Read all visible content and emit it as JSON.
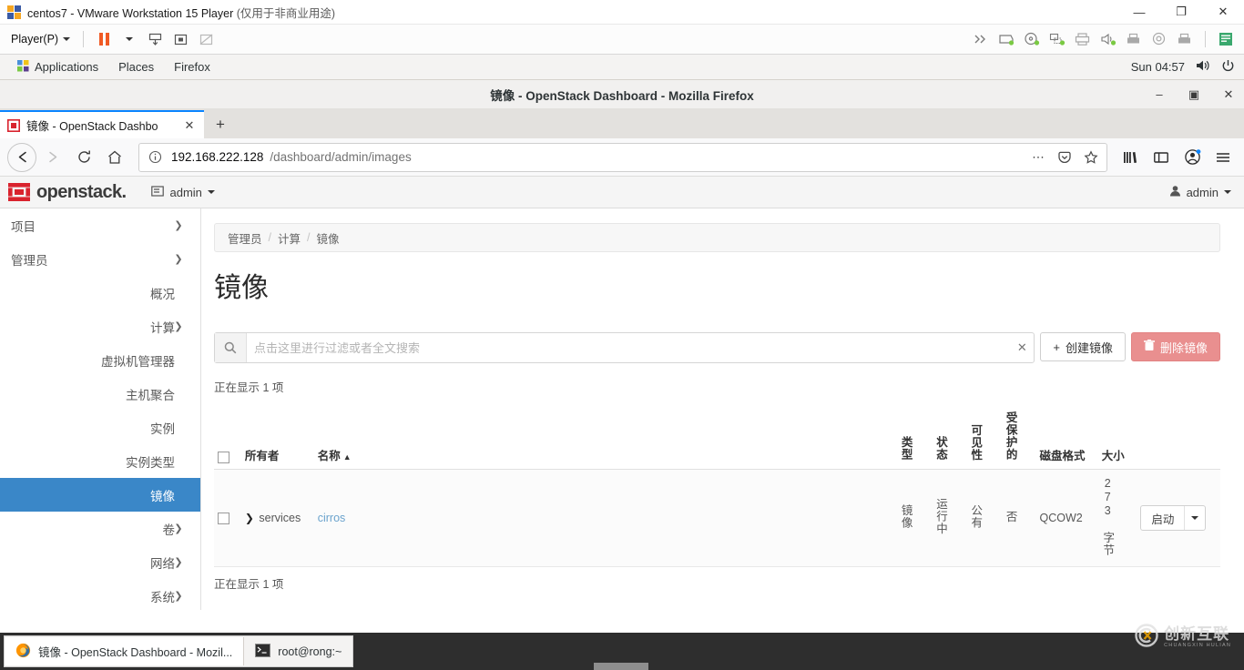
{
  "vmware": {
    "title_main": "centos7 - VMware Workstation 15 Player",
    "title_note": "(仅用于非商业用途)",
    "player_menu": "Player(P)",
    "toolbar_icons": [
      "send-keys-icon",
      "removable-hard-disk-icon",
      "cd-dvd-icon",
      "network-adapter-icon",
      "printer-icon",
      "sound-card-icon",
      "usb-device-icon",
      "display-icon",
      "usb-device-2-icon"
    ],
    "notes_icon": "notes-icon",
    "window_controls": {
      "minimize": "—",
      "maximize": "❐",
      "close": "✕"
    }
  },
  "gnome": {
    "items": [
      "Applications",
      "Places",
      "Firefox"
    ],
    "clock": "Sun 04:57",
    "volume_icon": "volume-icon",
    "power_icon": "power-icon"
  },
  "firefox": {
    "window_title": "镜像 - OpenStack Dashboard - Mozilla Firefox",
    "window_controls": {
      "minimize": "–",
      "restore": "▣",
      "close": "✕"
    },
    "tab": {
      "label": "镜像 - OpenStack Dashbo",
      "close": "✕",
      "favicon": "openstack-favicon"
    },
    "new_tab": "+",
    "nav": {
      "back": "←",
      "forward": "→",
      "reload": "⟳",
      "home": "⌂",
      "identity_icon": "info-circle-icon",
      "url_host": "192.168.222.128",
      "url_path": "/dashboard/admin/images",
      "page_actions": "⋯",
      "pocket_icon": "pocket-icon",
      "bookmark_icon": "star-icon",
      "library_icon": "library-icon",
      "sidebar_icon": "sidebars-icon",
      "account_icon": "account-icon",
      "menu_icon": "hamburger-menu-icon"
    }
  },
  "openstack": {
    "brand": "openstack.",
    "project_selector": "admin",
    "user_menu": "admin",
    "sidebar": [
      {
        "label": "项目",
        "level": 1,
        "chevron": "right",
        "active": false
      },
      {
        "label": "管理员",
        "level": 1,
        "chevron": "down",
        "active": false
      },
      {
        "label": "概况",
        "level": 3,
        "chevron": "",
        "active": false
      },
      {
        "label": "计算",
        "level": 2,
        "chevron": "down",
        "active": false
      },
      {
        "label": "虚拟机管理器",
        "level": 3,
        "chevron": "",
        "active": false
      },
      {
        "label": "主机聚合",
        "level": 3,
        "chevron": "",
        "active": false
      },
      {
        "label": "实例",
        "level": 3,
        "chevron": "",
        "active": false
      },
      {
        "label": "实例类型",
        "level": 3,
        "chevron": "",
        "active": false
      },
      {
        "label": "镜像",
        "level": 3,
        "chevron": "",
        "active": true
      },
      {
        "label": "卷",
        "level": 2,
        "chevron": "right",
        "active": false
      },
      {
        "label": "网络",
        "level": 2,
        "chevron": "right",
        "active": false
      },
      {
        "label": "系统",
        "level": 2,
        "chevron": "right",
        "active": false
      }
    ],
    "breadcrumb": [
      "管理员",
      "计算",
      "镜像"
    ],
    "breadcrumb_separator": "/",
    "page_title": "镜像",
    "search": {
      "placeholder": "点击这里进行过滤或者全文搜索",
      "value": "",
      "icon": "search-icon",
      "clear": "✕"
    },
    "buttons": {
      "create": "创建镜像",
      "create_icon": "+",
      "delete": "删除镜像",
      "delete_icon": "trash-icon"
    },
    "count_top": "正在显示 1 项",
    "count_bottom": "正在显示 1 项",
    "table": {
      "headers": {
        "select_all": "select-all-checkbox",
        "owner": "所有者",
        "name": "名称",
        "sort_caret": "▲",
        "type": "类型",
        "status": "状态",
        "visibility": "可见性",
        "protected": "受保护的",
        "disk_format": "磁盘格式",
        "size": "大小",
        "actions": ""
      },
      "rows": [
        {
          "owner": "services",
          "name": "cirros",
          "type": "镜像",
          "status": "运行中",
          "visibility": "公有",
          "protected": "否",
          "disk_format": "QCOW2",
          "size": "273 字节",
          "action_label": "启动",
          "action_caret": "▼",
          "expand_icon": "❯"
        }
      ]
    }
  },
  "taskbar": {
    "items": [
      {
        "label": "镜像 - OpenStack Dashboard - Mozil...",
        "icon": "firefox-icon",
        "active": true
      },
      {
        "label": "root@rong:~",
        "icon": "terminal-icon",
        "active": false
      }
    ]
  },
  "watermark": {
    "cn": "创新互联",
    "en": "CHUANGXIN HULIAN",
    "icon": "cx-logo-icon"
  }
}
